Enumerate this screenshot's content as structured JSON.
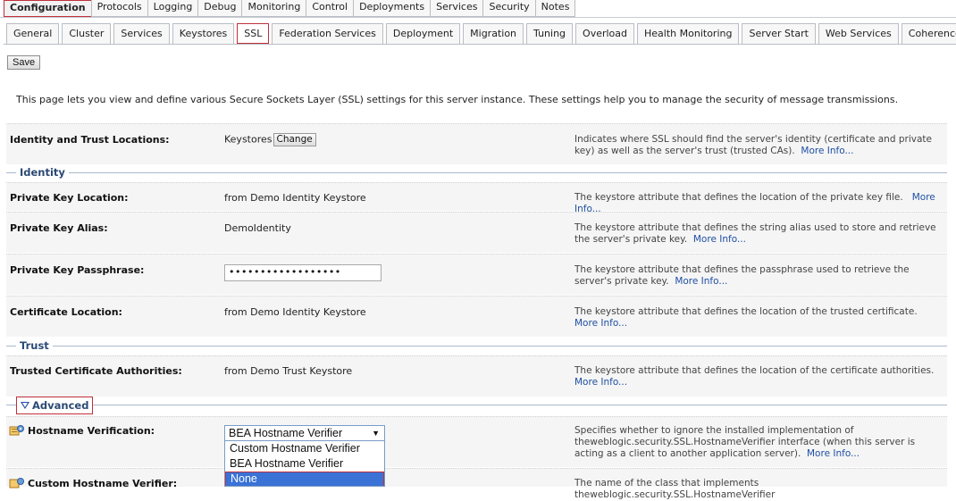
{
  "top_tabs": [
    "Configuration",
    "Protocols",
    "Logging",
    "Debug",
    "Monitoring",
    "Control",
    "Deployments",
    "Services",
    "Security",
    "Notes"
  ],
  "sub_tabs": [
    "General",
    "Cluster",
    "Services",
    "Keystores",
    "SSL",
    "Federation Services",
    "Deployment",
    "Migration",
    "Tuning",
    "Overload",
    "Health Monitoring",
    "Server Start",
    "Web Services",
    "Coherence"
  ],
  "active_top_tab": "Configuration",
  "active_sub_tab": "SSL",
  "save_label": "Save",
  "intro": "This page lets you view and define various Secure Sockets Layer (SSL) settings for this server instance. These settings help you to manage the security of message transmissions.",
  "more_info": "More Info...",
  "identity_trust": {
    "label": "Identity and Trust Locations:",
    "value": "Keystores",
    "change_label": "Change",
    "desc": "Indicates where SSL should find the server's identity (certificate and private key) as well as the server's trust (trusted CAs)."
  },
  "sections": {
    "identity": "Identity",
    "trust": "Trust",
    "advanced": "Advanced"
  },
  "private_key_location": {
    "label": "Private Key Location:",
    "value": "from Demo Identity Keystore",
    "desc": "The keystore attribute that defines the location of the private key file."
  },
  "private_key_alias": {
    "label": "Private Key Alias:",
    "value": "DemoIdentity",
    "desc": "The keystore attribute that defines the string alias used to store and retrieve the server's private key."
  },
  "private_key_passphrase": {
    "label": "Private Key Passphrase:",
    "value": "••••••••••••••••••",
    "desc": "The keystore attribute that defines the passphrase used to retrieve the server's private key."
  },
  "certificate_location": {
    "label": "Certificate Location:",
    "value": "from Demo Identity Keystore",
    "desc": "The keystore attribute that defines the location of the trusted certificate."
  },
  "trusted_cas": {
    "label": "Trusted Certificate Authorities:",
    "value": "from Demo Trust Keystore",
    "desc": "The keystore attribute that defines the location of the certificate authorities."
  },
  "hostname_verification": {
    "label": "Hostname Verification:",
    "selected": "BEA Hostname Verifier",
    "options": [
      "Custom Hostname Verifier",
      "BEA Hostname Verifier",
      "None"
    ],
    "highlighted_option": "None",
    "desc": "Specifies whether to ignore the installed implementation of theweblogic.security.SSL.HostnameVerifier interface (when this server is acting as a client to another application server)."
  },
  "custom_hostname_verifier": {
    "label": "Custom Hostname Verifier:",
    "desc": "The name of the class that implements theweblogic.security.SSL.HostnameVerifier"
  },
  "colors": {
    "accent_red": "#c0303a",
    "link_blue": "#1f4fa3",
    "section_blue": "#2c4a74",
    "dropdown_highlight": "#3a72d6"
  }
}
